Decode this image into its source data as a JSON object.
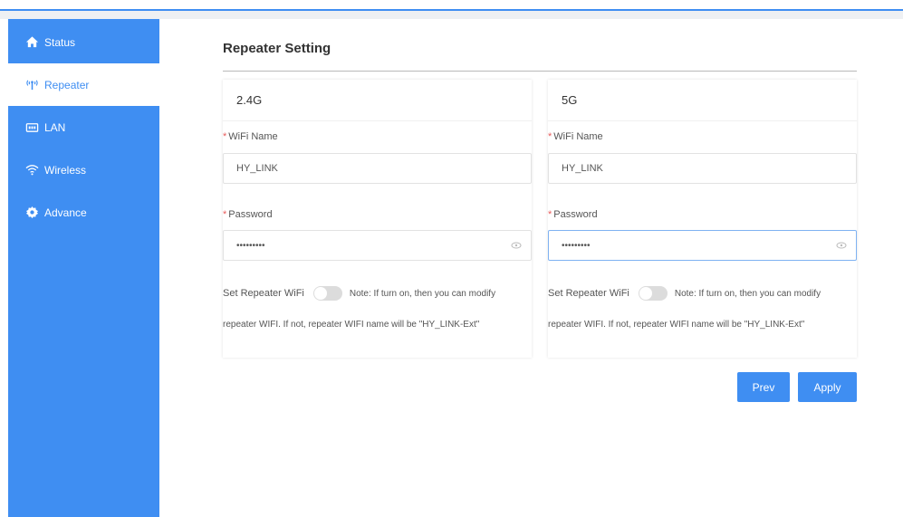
{
  "sidebar": {
    "items": [
      {
        "label": "Status",
        "icon": "home-icon"
      },
      {
        "label": "Repeater",
        "icon": "repeater-icon"
      },
      {
        "label": "LAN",
        "icon": "lan-icon"
      },
      {
        "label": "Wireless",
        "icon": "wifi-icon"
      },
      {
        "label": "Advance",
        "icon": "gear-icon"
      }
    ],
    "active_index": 1
  },
  "main": {
    "title": "Repeater Setting",
    "cards": [
      {
        "band": "2.4G",
        "wifi_name_label": "WiFi Name",
        "wifi_name_value": "HY_LINK",
        "password_label": "Password",
        "password_value": "•••••••••",
        "toggle_label": "Set Repeater WiFi",
        "note_line1": "Note: If turn on, then you can modify",
        "note_line2": "repeater WIFI. If not, repeater WIFI name will be \"HY_LINK-Ext\""
      },
      {
        "band": "5G",
        "wifi_name_label": "WiFi Name",
        "wifi_name_value": "HY_LINK",
        "password_label": "Password",
        "password_value": "•••••••••",
        "toggle_label": "Set Repeater WiFi",
        "note_line1": "Note: If turn on, then you can modify",
        "note_line2": "repeater WIFI. If not, repeater WIFI name will be \"HY_LINK-Ext\""
      }
    ],
    "prev_label": "Prev",
    "apply_label": "Apply"
  },
  "colors": {
    "accent": "#3f8ef2",
    "required": "#e85c5c"
  }
}
